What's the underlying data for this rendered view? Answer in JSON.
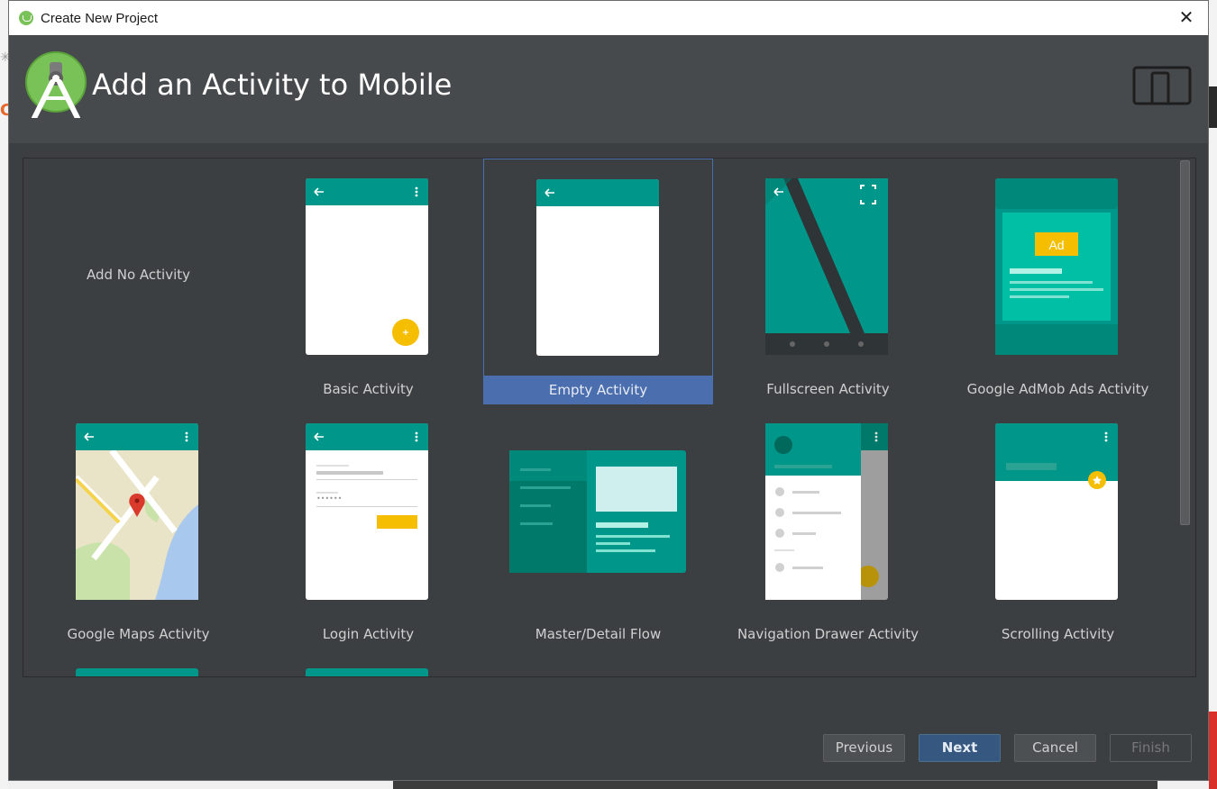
{
  "window": {
    "title": "Create New Project",
    "close_glyph": "✕"
  },
  "header": {
    "heading": "Add an Activity to Mobile",
    "logo_icon": "android-studio-logo-icon",
    "device_icon": "phone-tablet-icon"
  },
  "gallery": {
    "selected": "Empty Activity",
    "tiles": [
      {
        "label": "Add No Activity"
      },
      {
        "label": "Basic Activity"
      },
      {
        "label": "Empty Activity"
      },
      {
        "label": "Fullscreen Activity"
      },
      {
        "label": "Google AdMob Ads Activity"
      },
      {
        "label": "Google Maps Activity"
      },
      {
        "label": "Login Activity"
      },
      {
        "label": "Master/Detail Flow"
      },
      {
        "label": "Navigation Drawer Activity"
      },
      {
        "label": "Scrolling Activity"
      }
    ],
    "admob_badge": "Ad",
    "login_password_mask": "••••••"
  },
  "buttons": {
    "previous": "Previous",
    "next": "Next",
    "cancel": "Cancel",
    "finish": "Finish"
  },
  "colors": {
    "teal": "#00968a",
    "dark_teal": "#00796b",
    "fab_yellow": "#f5be00",
    "selection_blue": "#4b6eaf",
    "dialog_bg": "#3c3f41"
  }
}
